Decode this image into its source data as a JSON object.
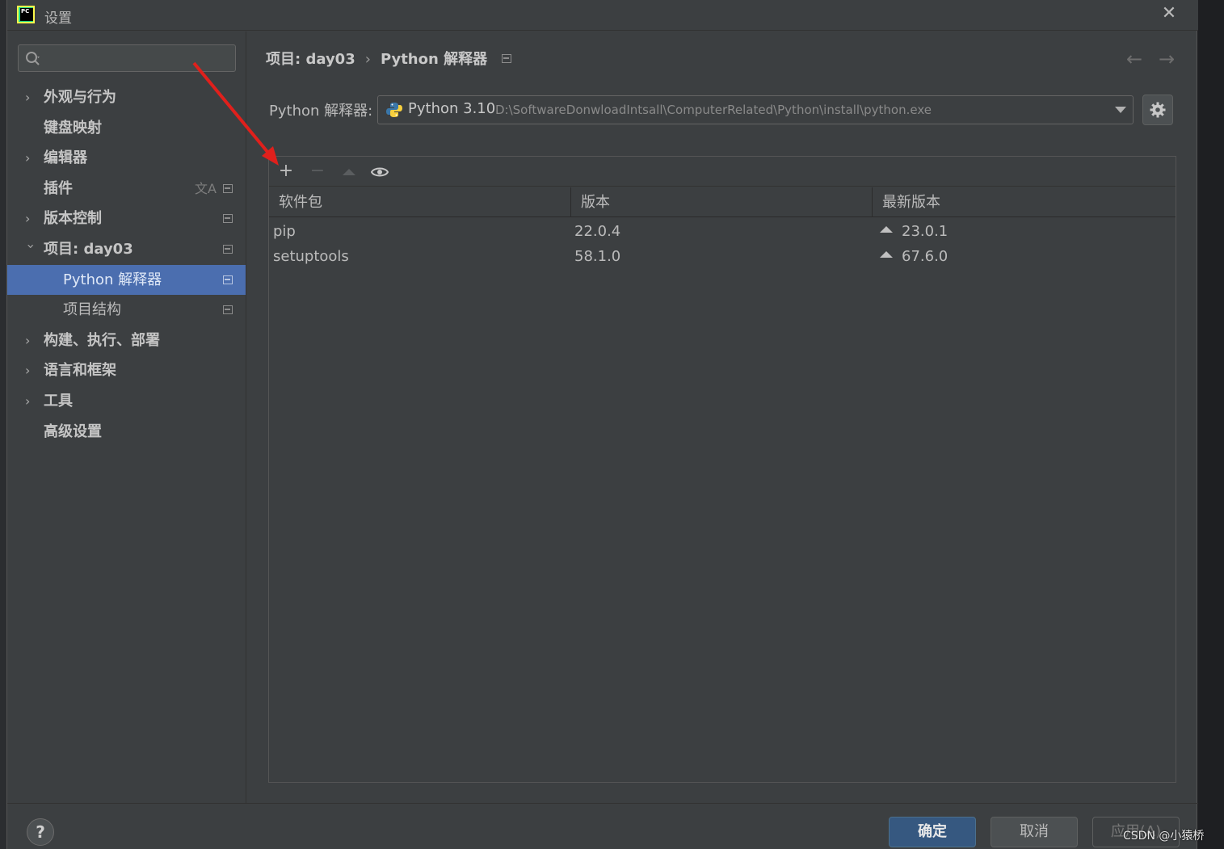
{
  "window": {
    "title": "设置",
    "close_icon": "close-icon"
  },
  "search": {
    "placeholder": ""
  },
  "sidebar": {
    "items": [
      {
        "label": "外观与行为",
        "expandable": true,
        "expanded": false,
        "bold": true
      },
      {
        "label": "键盘映射",
        "expandable": false,
        "bold": true
      },
      {
        "label": "编辑器",
        "expandable": true,
        "expanded": false,
        "bold": true
      },
      {
        "label": "插件",
        "expandable": false,
        "bold": true,
        "icons": [
          "translate-icon",
          "project-scope-icon"
        ]
      },
      {
        "label": "版本控制",
        "expandable": true,
        "expanded": false,
        "bold": true,
        "icons": [
          "project-scope-icon"
        ]
      },
      {
        "label": "项目: day03",
        "expandable": true,
        "expanded": true,
        "bold": true,
        "icons": [
          "project-scope-icon"
        ]
      },
      {
        "label": "Python 解释器",
        "child": true,
        "selected": true,
        "icons": [
          "project-scope-icon"
        ]
      },
      {
        "label": "项目结构",
        "child": true,
        "icons": [
          "project-scope-icon"
        ]
      },
      {
        "label": "构建、执行、部署",
        "expandable": true,
        "expanded": false,
        "bold": true
      },
      {
        "label": "语言和框架",
        "expandable": true,
        "expanded": false,
        "bold": true
      },
      {
        "label": "工具",
        "expandable": true,
        "expanded": false,
        "bold": true
      },
      {
        "label": "高级设置",
        "expandable": false,
        "bold": true
      }
    ]
  },
  "breadcrumb": {
    "parent": "项目: day03",
    "separator": "›",
    "current": "Python 解释器"
  },
  "nav": {
    "back": "←",
    "forward": "→"
  },
  "interpreter": {
    "label": "Python 解释器:",
    "name": "Python 3.10",
    "path": "D:\\SoftwareDonwloadIntsall\\ComputerRelated\\Python\\install\\python.exe"
  },
  "toolbar": {
    "add": "+",
    "remove": "−"
  },
  "packages": {
    "columns": [
      "软件包",
      "版本",
      "最新版本"
    ],
    "rows": [
      {
        "name": "pip",
        "version": "22.0.4",
        "latest": "23.0.1"
      },
      {
        "name": "setuptools",
        "version": "58.1.0",
        "latest": "67.6.0"
      }
    ]
  },
  "buttons": {
    "help": "?",
    "ok": "确定",
    "cancel": "取消",
    "apply": "应用(A)"
  },
  "watermark": "CSDN @小猿桥",
  "colors": {
    "selection": "#4b6eaf",
    "background": "#3c3f41",
    "ok_button": "#365880",
    "annotation_arrow": "#e0201c"
  }
}
